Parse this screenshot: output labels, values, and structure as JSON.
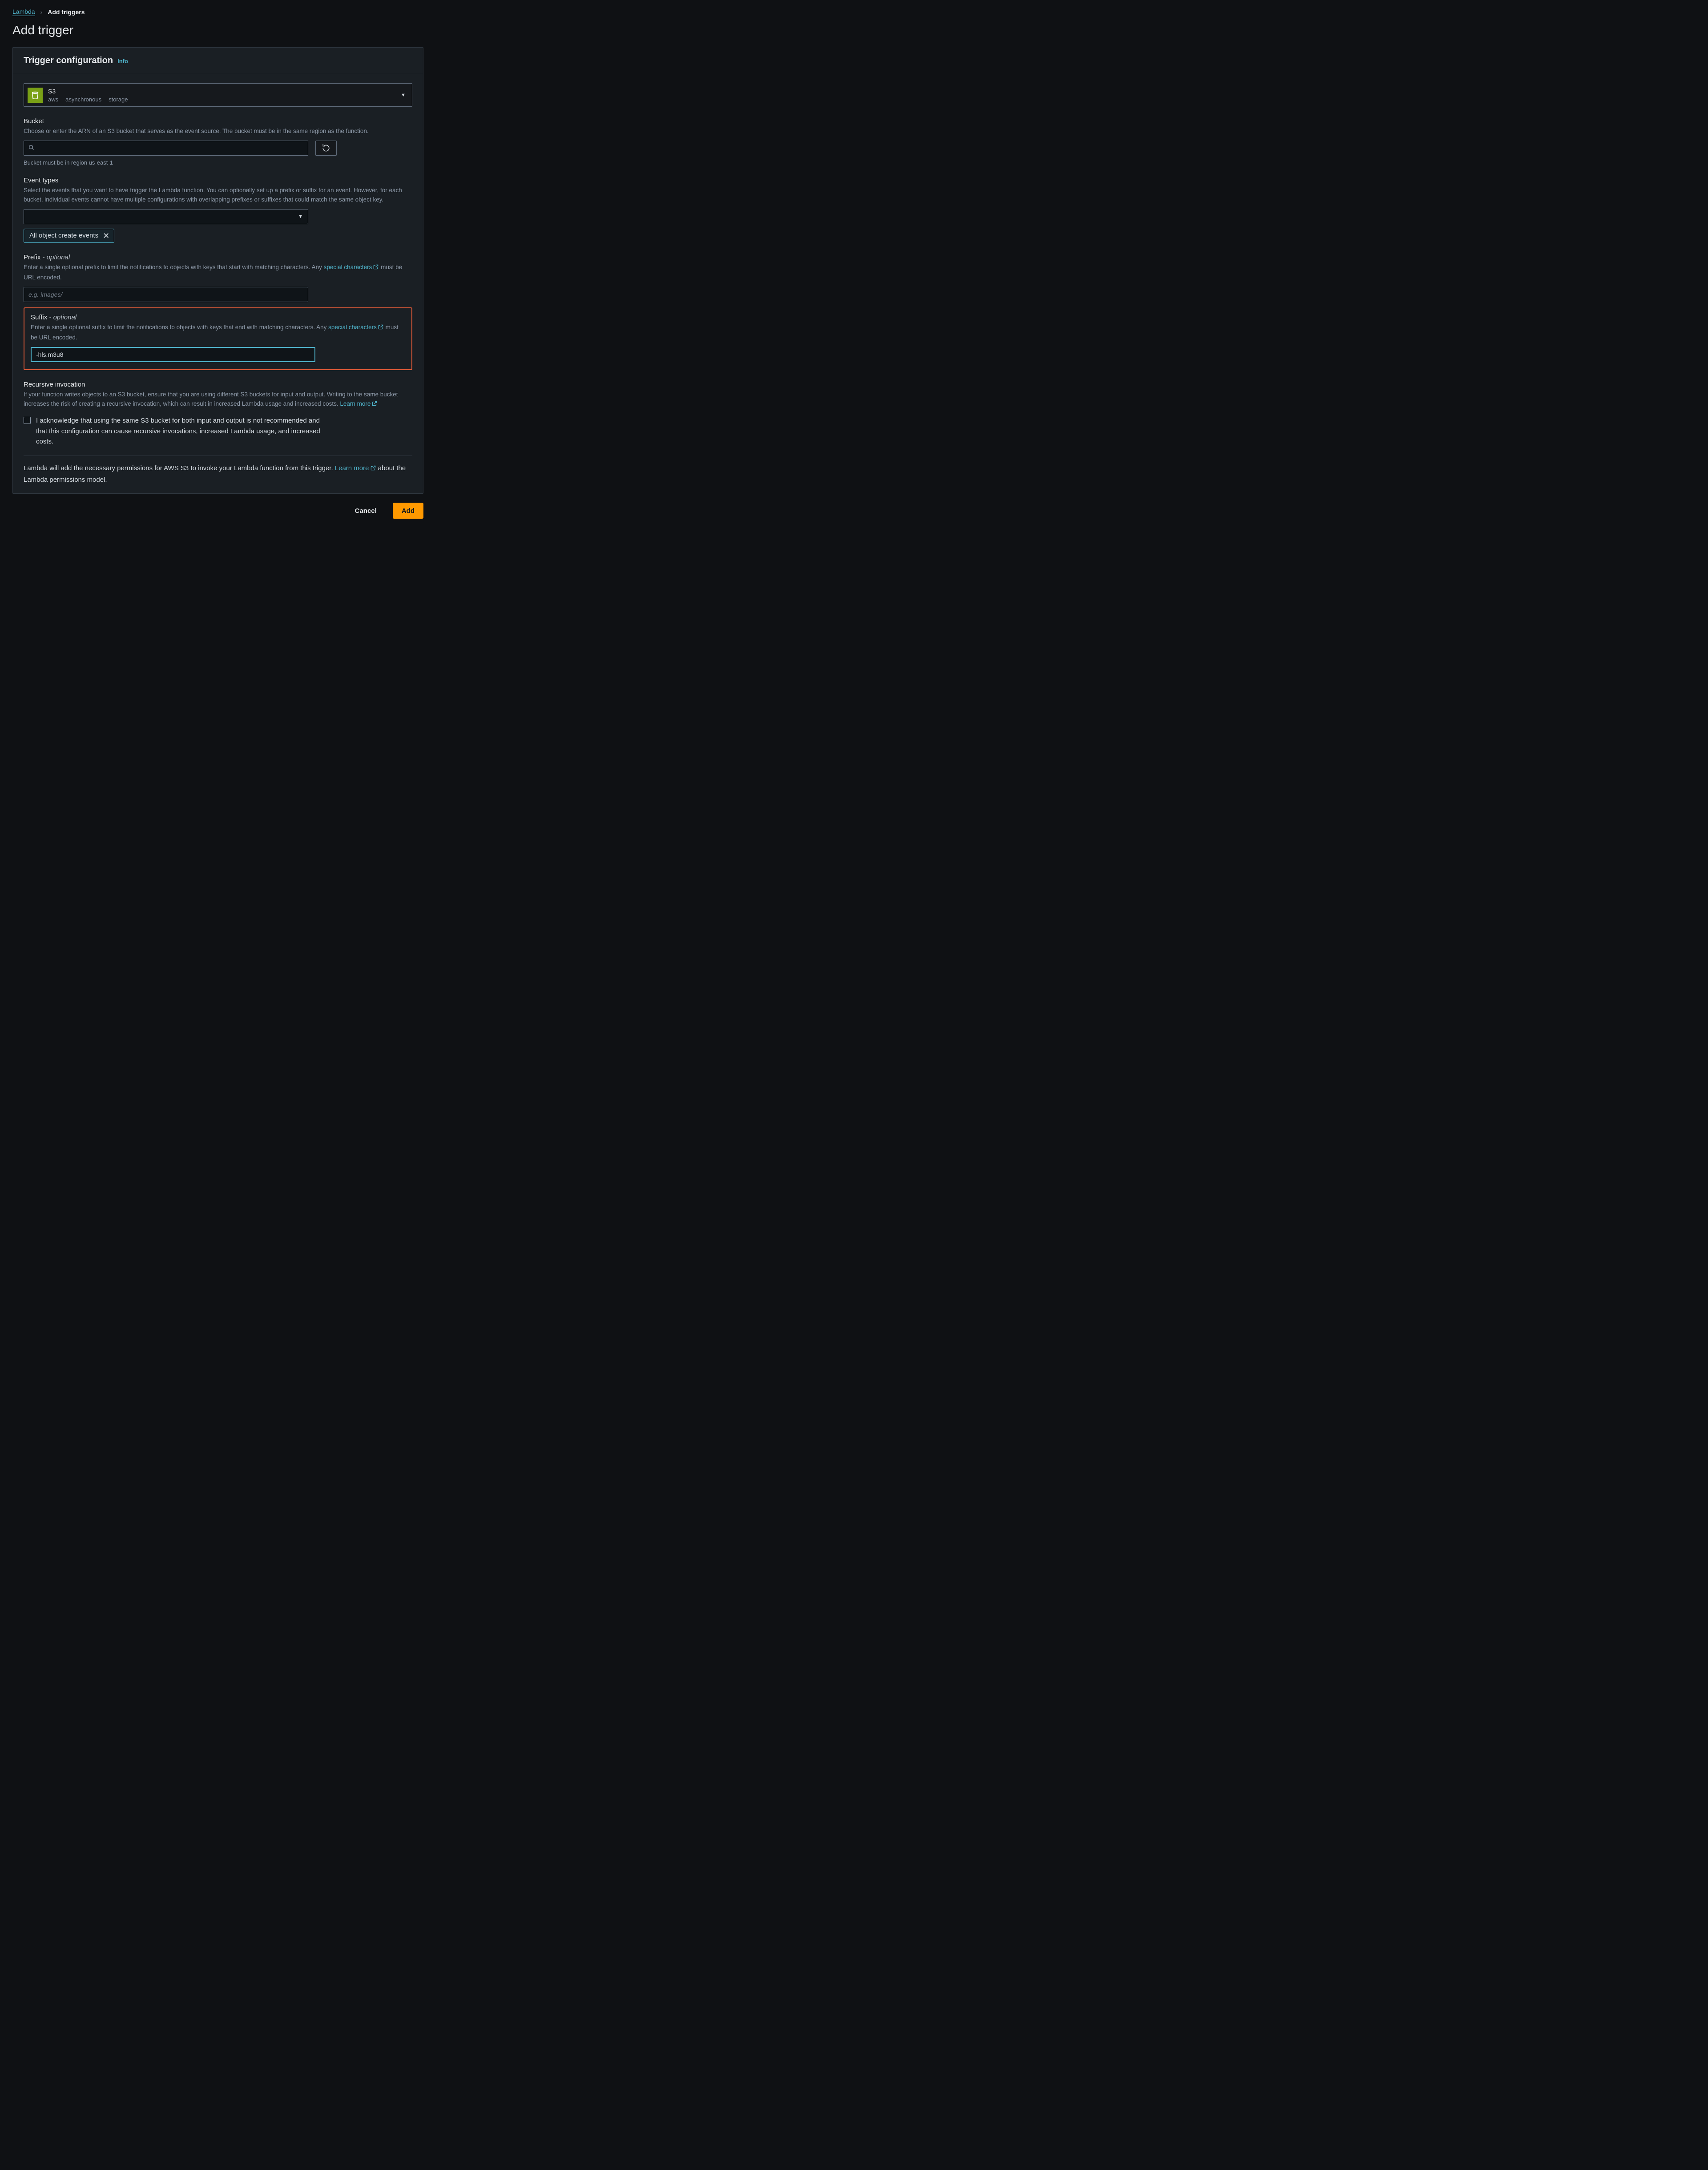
{
  "breadcrumbs": {
    "root": "Lambda",
    "current": "Add triggers"
  },
  "page_title": "Add trigger",
  "panel": {
    "title": "Trigger configuration",
    "info": "Info"
  },
  "source": {
    "title": "S3",
    "tags": [
      "aws",
      "asynchronous",
      "storage"
    ]
  },
  "bucket": {
    "label": "Bucket",
    "desc": "Choose or enter the ARN of an S3 bucket that serves as the event source. The bucket must be in the same region as the function.",
    "value": "",
    "hint": "Bucket must be in region us-east-1"
  },
  "event_types": {
    "label": "Event types",
    "desc": "Select the events that you want to have trigger the Lambda function. You can optionally set up a prefix or suffix for an event. However, for each bucket, individual events cannot have multiple configurations with overlapping prefixes or suffixes that could match the same object key.",
    "selected_token": "All object create events"
  },
  "prefix": {
    "label": "Prefix",
    "optional": "- optional",
    "desc_pre": "Enter a single optional prefix to limit the notifications to objects with keys that start with matching characters. Any ",
    "special": "special characters",
    "desc_post": " must be URL encoded.",
    "placeholder": "e.g. images/",
    "value": ""
  },
  "suffix": {
    "label": "Suffix",
    "optional": "- optional",
    "desc_pre": "Enter a single optional suffix to limit the notifications to objects with keys that end with matching characters. Any ",
    "special": "special characters",
    "desc_post": " must be URL encoded.",
    "value": "-hls.m3u8"
  },
  "recursive": {
    "label": "Recursive invocation",
    "desc": "If your function writes objects to an S3 bucket, ensure that you are using different S3 buckets for input and output. Writing to the same bucket increases the risk of creating a recursive invocation, which can result in increased Lambda usage and increased costs. ",
    "learn_more": "Learn more",
    "ack": "I acknowledge that using the same S3 bucket for both input and output is not recommended and that this configuration can cause recursive invocations, increased Lambda usage, and increased costs."
  },
  "footnote": {
    "pre": "Lambda will add the necessary permissions for AWS S3 to invoke your Lambda function from this trigger. ",
    "learn_more": "Learn more",
    "post": " about the Lambda permissions model."
  },
  "buttons": {
    "cancel": "Cancel",
    "add": "Add"
  }
}
